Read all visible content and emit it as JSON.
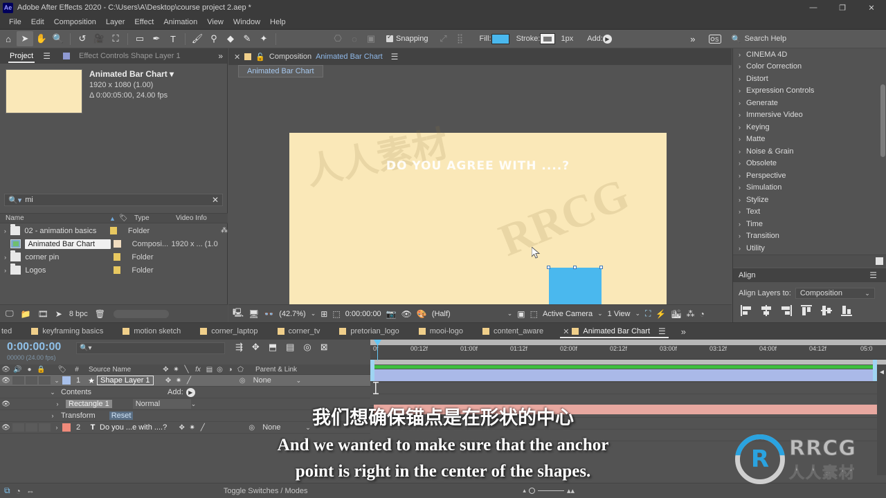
{
  "window": {
    "app_icon": "Ae",
    "title": "Adobe After Effects 2020 - C:\\Users\\A\\Desktop\\course project 2.aep *",
    "minimize": "—",
    "restore": "❐",
    "close": "✕"
  },
  "menubar": {
    "items": [
      "File",
      "Edit",
      "Composition",
      "Layer",
      "Effect",
      "Animation",
      "View",
      "Window",
      "Help"
    ]
  },
  "toolbar": {
    "tools": [
      {
        "name": "home-icon",
        "glyph": "⌂"
      },
      {
        "name": "selection-tool-icon",
        "glyph": "➤"
      },
      {
        "name": "hand-tool-icon",
        "glyph": "✋"
      },
      {
        "name": "zoom-tool-icon",
        "glyph": "🔍"
      },
      {
        "name": "rotation-tool-icon",
        "glyph": "↺"
      },
      {
        "name": "camera-tool-icon",
        "glyph": "🎥"
      },
      {
        "name": "pan-behind-tool-icon",
        "glyph": "⛶"
      },
      {
        "name": "shape-tool-icon",
        "glyph": "▭"
      },
      {
        "name": "pen-tool-icon",
        "glyph": "✒"
      },
      {
        "name": "type-tool-icon",
        "glyph": "T"
      },
      {
        "name": "brush-tool-icon",
        "glyph": "🖌"
      },
      {
        "name": "clone-stamp-tool-icon",
        "glyph": "⚲"
      },
      {
        "name": "eraser-tool-icon",
        "glyph": "◆"
      },
      {
        "name": "roto-brush-tool-icon",
        "glyph": "✎"
      },
      {
        "name": "puppet-pin-tool-icon",
        "glyph": "✦"
      }
    ],
    "dim_tools": [
      {
        "name": "mask-feather-icon",
        "glyph": "⎔"
      },
      {
        "name": "opacity-icon",
        "glyph": "◌"
      },
      {
        "name": "expansion-icon",
        "glyph": "▣"
      }
    ],
    "snapping_label": "Snapping",
    "snapping_checked": true,
    "align_icon": "⤢",
    "distribute_icon": "⣿",
    "fill_label": "Fill:",
    "fill_color": "#4ab8ee",
    "stroke_label": "Stroke:",
    "stroke_color": "#f0f0f0",
    "stroke_width": "1",
    "stroke_unit": "px",
    "add_label": "Add:",
    "overflow_icon": "»",
    "workspace_icon": "⚙",
    "search_help_placeholder": "Search Help",
    "search_icon": "search-icon"
  },
  "project_panel": {
    "tabs": [
      {
        "label": "Project",
        "active": true
      },
      {
        "label": "Effect Controls Shape Layer 1",
        "active": false
      }
    ],
    "hamburger": "☰",
    "overflow": "»",
    "item": {
      "title": "Animated Bar Chart",
      "dropdown_caret": "▾",
      "resolution": "1920 x 1080 (1.00)",
      "duration": "Δ 0:00:05:00, 24.00 fps"
    },
    "search": {
      "value": "mi",
      "clear_icon": "✕",
      "search_icon": "search-icon"
    },
    "columns": [
      "Name",
      "Type",
      "Video Info"
    ],
    "sort_arrow": "▲",
    "rows": [
      {
        "twirl": "›",
        "icon": "folder",
        "name": "02 - animation basics",
        "chip": "#e8c860",
        "type": "Folder",
        "video_info": "",
        "selected": false,
        "extra_icon": "⁂"
      },
      {
        "twirl": "",
        "icon": "comp",
        "name": "Animated Bar Chart",
        "chip": "#f0ddc0",
        "type": "Composi...",
        "video_info": "1920 x ... (1.0",
        "selected": true,
        "extra_icon": ""
      },
      {
        "twirl": "›",
        "icon": "folder",
        "name": "corner pin",
        "chip": "#e8c860",
        "type": "Folder",
        "video_info": "",
        "selected": false,
        "extra_icon": ""
      },
      {
        "twirl": "›",
        "icon": "folder",
        "name": "Logos",
        "chip": "#e8c860",
        "type": "Folder",
        "video_info": "",
        "selected": false,
        "extra_icon": ""
      }
    ],
    "footer": {
      "bpc_label": "8 bpc",
      "icons": [
        "new-comp-icon",
        "new-folder-icon",
        "project-settings-icon",
        "interpret-footage-icon",
        "delete-icon"
      ]
    }
  },
  "composition_panel": {
    "close_icon": "✕",
    "panel_label": "Composition",
    "comp_name": "Animated Bar Chart",
    "lock_icon": "🔒",
    "hamburger": "☰",
    "breadcrumb": "Animated Bar Chart",
    "canvas": {
      "title_text": "DO YOU AGREE WITH ....?",
      "background_color": "#fae8b8",
      "bar_color": "#4ab8ee"
    },
    "bottom_bar": {
      "magnification": "(42.7%)",
      "timecode": "0:00:00:00",
      "resolution": "(Half)",
      "camera": "Active Camera",
      "view_count": "1 View",
      "caret": "⌄"
    }
  },
  "effects_panel": {
    "categories": [
      "CINEMA 4D",
      "Color Correction",
      "Distort",
      "Expression Controls",
      "Generate",
      "Immersive Video",
      "Keying",
      "Matte",
      "Noise & Grain",
      "Obsolete",
      "Perspective",
      "Simulation",
      "Stylize",
      "Text",
      "Time",
      "Transition",
      "Utility"
    ],
    "twirl": "›"
  },
  "align_panel": {
    "title": "Align",
    "hamburger": "☰",
    "layers_to_label": "Align Layers to:",
    "layers_to_value": "Composition",
    "caret": "⌄",
    "buttons": [
      "align-left-icon",
      "align-horizontal-center-icon",
      "align-right-icon",
      "align-top-icon",
      "align-vertical-center-icon",
      "align-bottom-icon"
    ]
  },
  "timeline": {
    "tabs": [
      {
        "label": "ted",
        "active": false
      },
      {
        "label": "keyframing basics",
        "active": false
      },
      {
        "label": "motion sketch",
        "active": false
      },
      {
        "label": "corner_laptop",
        "active": false
      },
      {
        "label": "corner_tv",
        "active": false
      },
      {
        "label": "pretorian_logo",
        "active": false
      },
      {
        "label": "mooi-logo",
        "active": false
      },
      {
        "label": "content_aware",
        "active": false
      },
      {
        "label": "Animated Bar Chart",
        "active": true
      }
    ],
    "overflow": "»",
    "hamburger": "☰",
    "current_time": "0:00:00:00",
    "frame_rate_note": "00000 (24.00 fps)",
    "search_icon": "search-icon",
    "header_icons": [
      "motion-blur-icon",
      "3d-renderer-icon",
      "draft-3d-icon",
      "hide-shy-icon",
      "frame-blend-icon",
      "graph-editor-icon"
    ],
    "column_headers": [
      "#",
      "Source Name",
      "Parent & Link"
    ],
    "switch_icons": [
      "shy-icon",
      "collapse-icon",
      "quality-icon",
      "effects-icon",
      "frame-blend-icon",
      "motion-blur-icon",
      "adjustment-icon",
      "3d-icon"
    ],
    "ruler_ticks": [
      "00:12f",
      "01:00f",
      "01:12f",
      "02:00f",
      "02:12f",
      "03:00f",
      "03:12f",
      "04:00f",
      "04:12f",
      "05:0"
    ],
    "ruler_start": "0f",
    "layers": [
      {
        "num": "1",
        "name": "Shape Layer 1",
        "type_icon": "star-icon",
        "color": "#a8c0ea",
        "selected": true,
        "editing": true,
        "parent": "None"
      },
      {
        "num": "",
        "name": "Contents",
        "type_icon": "",
        "color": "",
        "selected": false,
        "editing": false,
        "add_label": "Add:",
        "indent": 2
      },
      {
        "num": "",
        "name": "Rectangle 1",
        "type_icon": "",
        "color": "",
        "selected": false,
        "editing": false,
        "mode": "Normal",
        "indent": 3
      },
      {
        "num": "",
        "name": "Transform",
        "type_icon": "",
        "color": "",
        "selected": false,
        "editing": false,
        "reset": "Reset",
        "indent": 3
      },
      {
        "num": "2",
        "name": "Do you ...e with ....?",
        "type_icon": "T",
        "color": "#f08a7a",
        "selected": false,
        "editing": false,
        "parent": "None"
      }
    ],
    "footer": {
      "toggle_label": "Toggle Switches / Modes"
    }
  },
  "subtitles": {
    "chinese": "我们想确保锚点是在形状的中心",
    "english_line1": "And we wanted to make sure that the anchor",
    "english_line2": "point is right in the center of the shapes."
  },
  "watermark": {
    "brand": "RRCG",
    "brand_cn": "人人素材",
    "mark_glyph": "R"
  }
}
